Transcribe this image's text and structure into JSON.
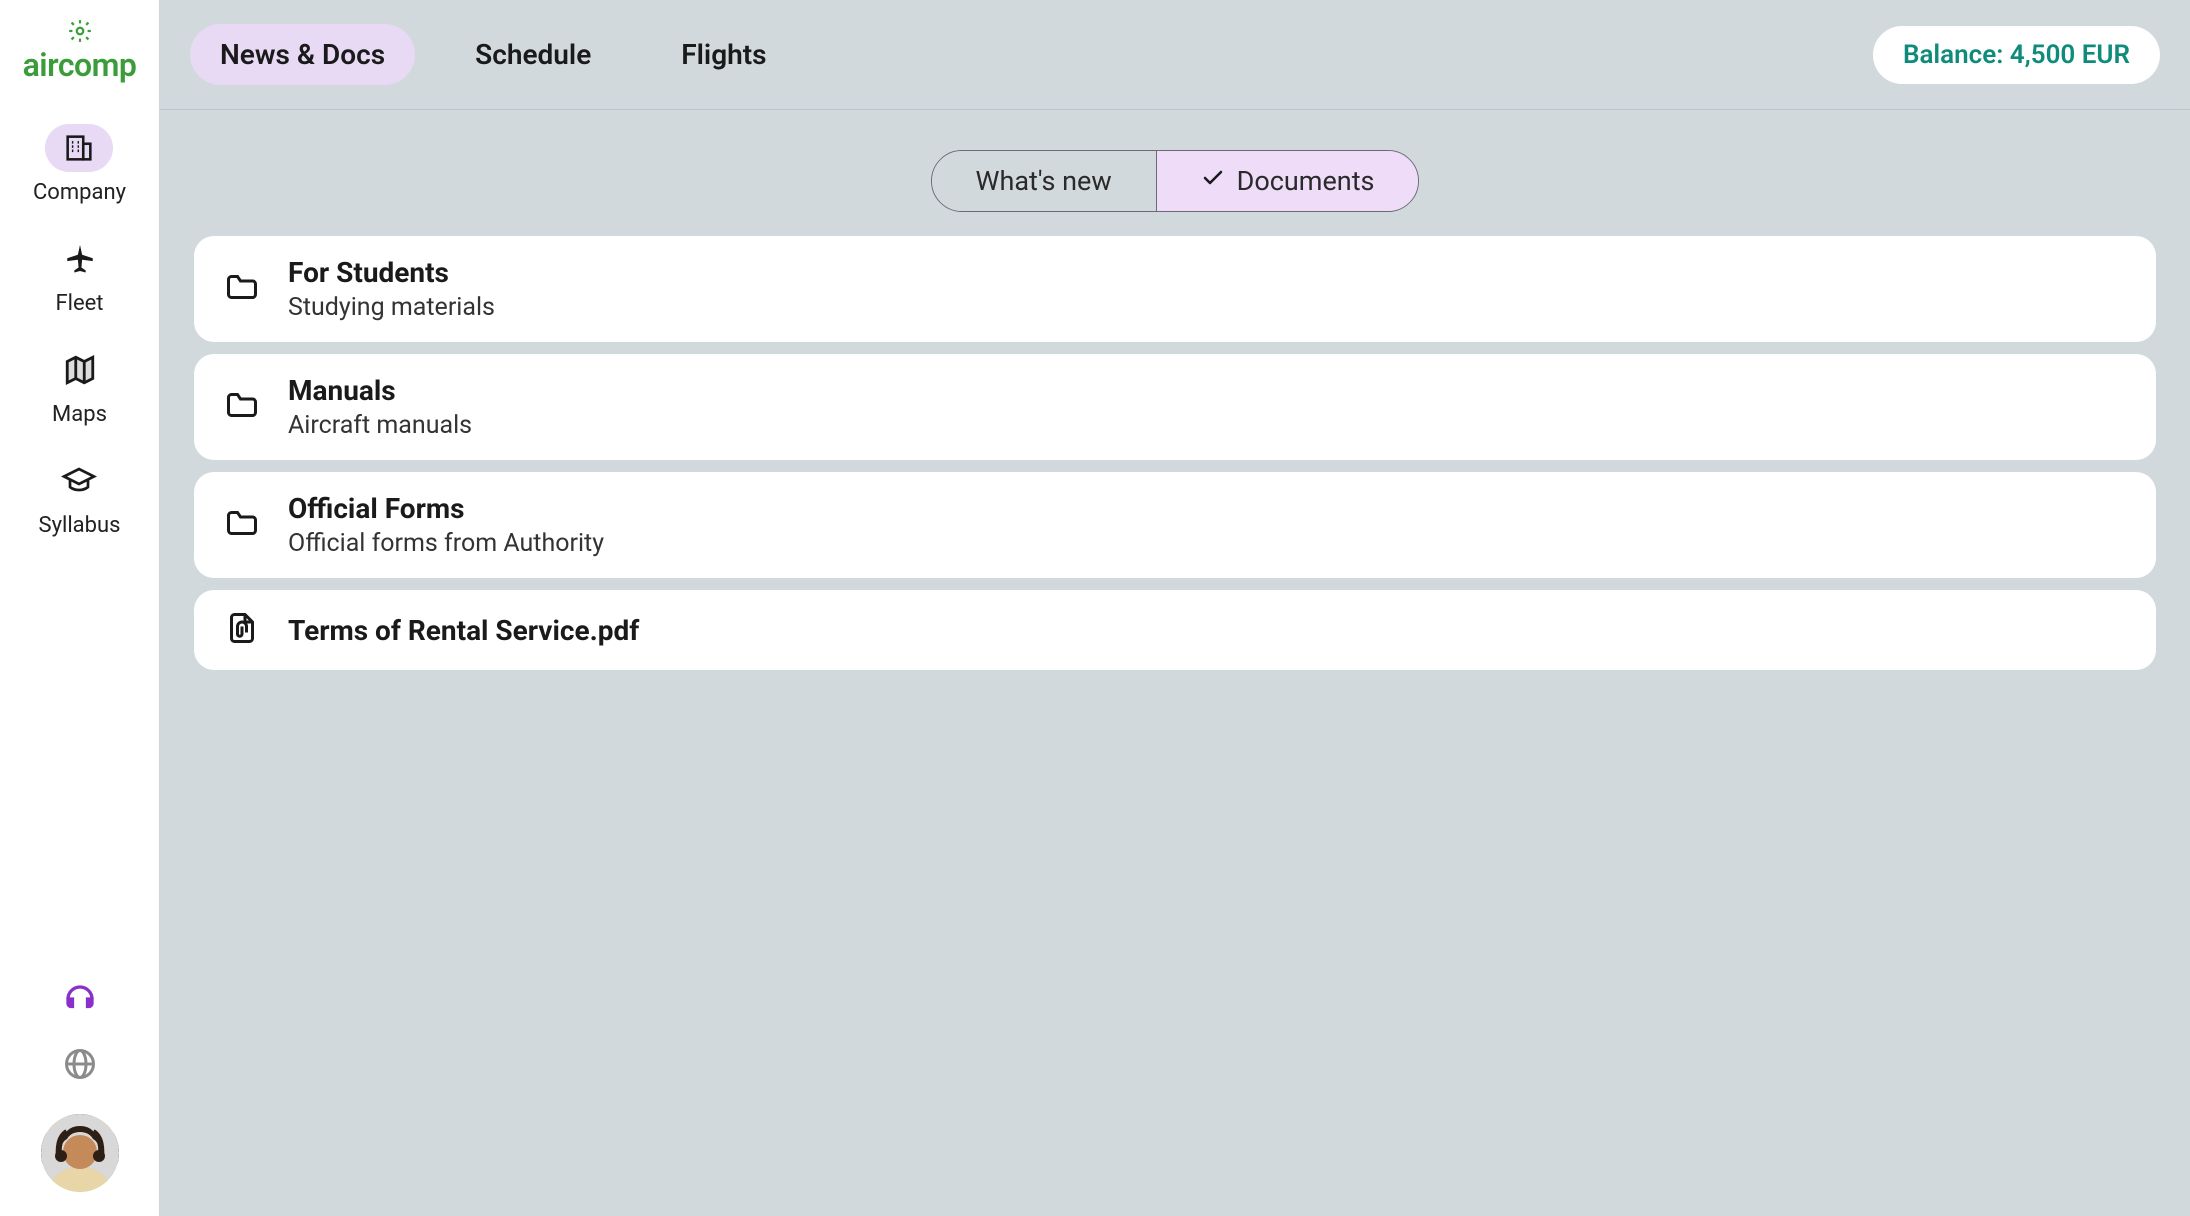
{
  "brand": {
    "name": "aircomp"
  },
  "sidebar": {
    "items": [
      {
        "label": "Company",
        "active": true
      },
      {
        "label": "Fleet",
        "active": false
      },
      {
        "label": "Maps",
        "active": false
      },
      {
        "label": "Syllabus",
        "active": false
      }
    ]
  },
  "topnav": {
    "items": [
      {
        "label": "News & Docs",
        "active": true
      },
      {
        "label": "Schedule",
        "active": false
      },
      {
        "label": "Flights",
        "active": false
      }
    ]
  },
  "balance": {
    "label": "Balance: 4,500 EUR"
  },
  "tabs": {
    "whatsnew": "What's new",
    "documents": "Documents"
  },
  "documents": [
    {
      "type": "folder",
      "title": "For Students",
      "subtitle": "Studying materials"
    },
    {
      "type": "folder",
      "title": "Manuals",
      "subtitle": "Aircraft manuals"
    },
    {
      "type": "folder",
      "title": "Official Forms",
      "subtitle": "Official forms from Authority"
    },
    {
      "type": "file",
      "title": "Terms of Rental Service.pdf"
    }
  ]
}
